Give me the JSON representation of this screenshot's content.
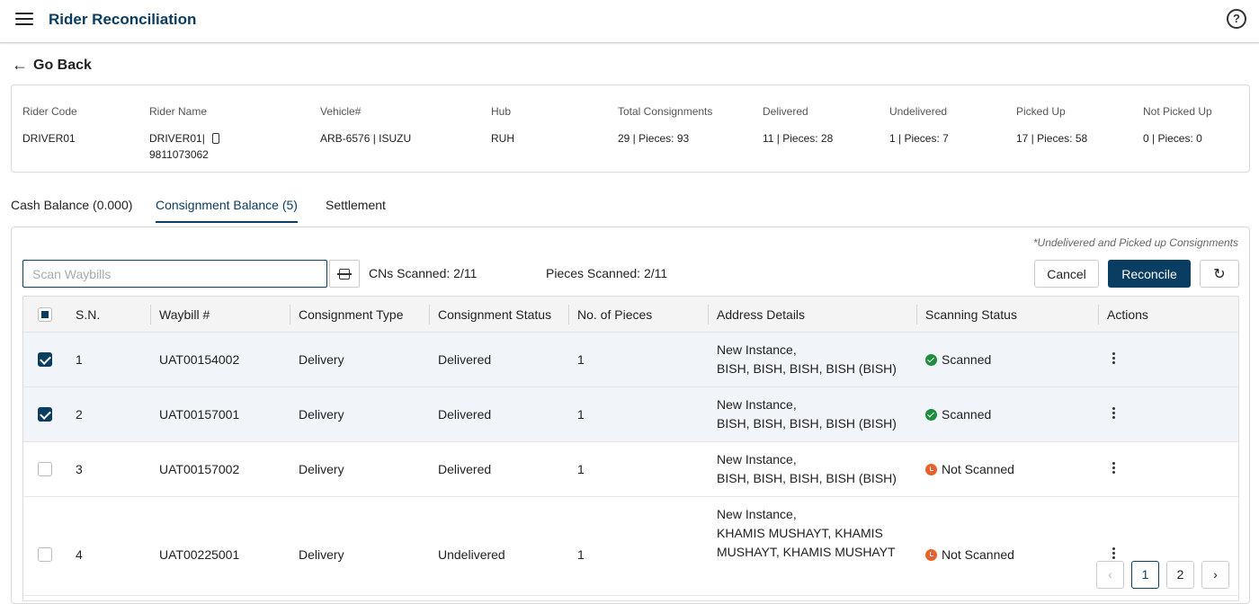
{
  "header": {
    "title": "Rider Reconciliation",
    "menu_icon": "hamburger-icon",
    "help_icon": "help-circle-icon",
    "help_glyph": "?"
  },
  "nav": {
    "go_back_label": "Go Back",
    "back_arrow": "←"
  },
  "rider_info": {
    "rider_code": {
      "label": "Rider Code",
      "value": "DRIVER01"
    },
    "rider_name": {
      "label": "Rider Name",
      "value": "DRIVER01|",
      "phone": "9811073062"
    },
    "vehicle": {
      "label": "Vehicle#",
      "value": "ARB-6576 | ISUZU"
    },
    "hub": {
      "label": "Hub",
      "value": "RUH"
    },
    "total": {
      "label": "Total Consignments",
      "value": "29 | Pieces: 93"
    },
    "delivered": {
      "label": "Delivered",
      "value": "11 | Pieces: 28"
    },
    "undelivered": {
      "label": "Undelivered",
      "value": "1 | Pieces: 7"
    },
    "picked_up": {
      "label": "Picked Up",
      "value": "17 | Pieces: 58"
    },
    "not_picked_up": {
      "label": "Not Picked Up",
      "value": "0 | Pieces: 0"
    }
  },
  "tabs": [
    {
      "label": "Cash Balance (0.000)"
    },
    {
      "label": "Consignment Balance (5)"
    },
    {
      "label": "Settlement"
    }
  ],
  "active_tab": "Consignment Balance (5)",
  "toolbar": {
    "note": "*Undelivered and Picked up Consignments",
    "scan_placeholder": "Scan Waybills",
    "cns_scanned": "CNs Scanned:  2/11",
    "pieces_scanned": "Pieces Scanned:  2/11",
    "cancel_label": "Cancel",
    "reconcile_label": "Reconcile",
    "refresh_glyph": "↻"
  },
  "table": {
    "columns": [
      "S.N.",
      "Waybill #",
      "Consignment Type",
      "Consignment Status",
      "No. of Pieces",
      "Address Details",
      "Scanning Status",
      "Actions"
    ],
    "rows": [
      {
        "checked": true,
        "sn": "1",
        "waybill": "UAT00154002",
        "type": "Delivery",
        "status": "Delivered",
        "pieces": "1",
        "address_line1": "New Instance,",
        "address_line2": "BISH, BISH, BISH, BISH (BISH)",
        "address_line3": "",
        "scan": "Scanned"
      },
      {
        "checked": true,
        "sn": "2",
        "waybill": "UAT00157001",
        "type": "Delivery",
        "status": "Delivered",
        "pieces": "1",
        "address_line1": "New Instance,",
        "address_line2": "BISH, BISH, BISH, BISH (BISH)",
        "address_line3": "",
        "scan": "Scanned"
      },
      {
        "checked": false,
        "sn": "3",
        "waybill": "UAT00157002",
        "type": "Delivery",
        "status": "Delivered",
        "pieces": "1",
        "address_line1": "New Instance,",
        "address_line2": "BISH, BISH, BISH, BISH (BISH)",
        "address_line3": "",
        "scan": "Not Scanned"
      },
      {
        "checked": false,
        "sn": "4",
        "waybill": "UAT00225001",
        "type": "Delivery",
        "status": "Undelivered",
        "pieces": "1",
        "address_line1": "New Instance,",
        "address_line2": "KHAMIS MUSHAYT, KHAMIS",
        "address_line3": "MUSHAYT, KHAMIS MUSHAYT",
        "scan": "Not Scanned"
      }
    ]
  },
  "pagination": {
    "prev": "‹",
    "pages": [
      "1",
      "2"
    ],
    "next": "›",
    "current": "1"
  },
  "colors": {
    "primary": "#0a3d62",
    "scanned": "#1e8e3e",
    "not_scanned": "#e8632b"
  }
}
